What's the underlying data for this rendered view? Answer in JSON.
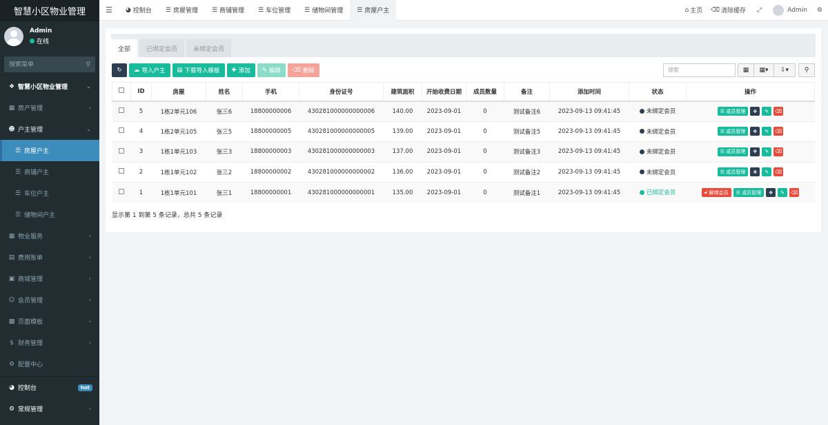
{
  "brand": "智慧小区物业管理",
  "user": {
    "name": "Admin",
    "status": "在线"
  },
  "sidebar": {
    "search_placeholder": "搜索菜单",
    "items": [
      {
        "label": "智慧小区物业管理",
        "icon": "cubes-icon"
      },
      {
        "label": "房产管理",
        "icon": "building-icon"
      },
      {
        "label": "户主管理",
        "icon": "user-icon"
      },
      {
        "label": "房屋户主",
        "icon": "list-icon"
      },
      {
        "label": "商铺户主",
        "icon": "list-icon"
      },
      {
        "label": "车位户主",
        "icon": "list-icon"
      },
      {
        "label": "储物间户主",
        "icon": "list-icon"
      },
      {
        "label": "物业服务",
        "icon": "table-icon"
      },
      {
        "label": "费用账单",
        "icon": "file-icon"
      },
      {
        "label": "商城管理",
        "icon": "store-icon"
      },
      {
        "label": "会员管理",
        "icon": "user-circle-icon"
      },
      {
        "label": "页面模板",
        "icon": "window-icon"
      },
      {
        "label": "财务管理",
        "icon": "dollar-icon"
      },
      {
        "label": "配置中心",
        "icon": "gear-icon"
      },
      {
        "label": "控制台",
        "icon": "dashboard-icon",
        "badge": "hot"
      },
      {
        "label": "常规管理",
        "icon": "cogs-icon"
      }
    ]
  },
  "topbar": {
    "tabs": [
      {
        "label": "控制台",
        "icon": "dashboard-icon"
      },
      {
        "label": "房屋管理",
        "icon": "list-icon"
      },
      {
        "label": "商铺管理",
        "icon": "list-icon"
      },
      {
        "label": "车位管理",
        "icon": "list-icon"
      },
      {
        "label": "储物间管理",
        "icon": "list-icon"
      },
      {
        "label": "房屋户主",
        "icon": "list-icon"
      }
    ],
    "home": "主页",
    "clear_cache": "清除缓存",
    "user": "Admin"
  },
  "panel": {
    "tabs": [
      "全部",
      "已绑定会员",
      "未绑定会员"
    ],
    "buttons": {
      "import": "导入户主",
      "download": "下载导入模板",
      "add": "添加",
      "edit": "编辑",
      "delete": "删除"
    },
    "search_placeholder": "搜索",
    "columns": [
      "ID",
      "房屋",
      "姓名",
      "手机",
      "身份证号",
      "建筑面积",
      "开始收费日期",
      "成员数量",
      "备注",
      "添加时间",
      "状态",
      "操作"
    ],
    "rows": [
      {
        "id": "5",
        "house": "1栋2单元106",
        "name": "张三6",
        "phone": "18800000006",
        "idcard": "430281000000000006",
        "area": "140.00",
        "start": "2023-09-01",
        "members": "0",
        "remark": "测试备注6",
        "added": "2023-09-13 09:41:45",
        "status": "未绑定会员",
        "bound": false
      },
      {
        "id": "4",
        "house": "1栋2单元105",
        "name": "张三5",
        "phone": "18800000005",
        "idcard": "430281000000000005",
        "area": "139.00",
        "start": "2023-09-01",
        "members": "0",
        "remark": "测试备注5",
        "added": "2023-09-13 09:41:45",
        "status": "未绑定会员",
        "bound": false
      },
      {
        "id": "3",
        "house": "1栋1单元103",
        "name": "张三3",
        "phone": "18800000003",
        "idcard": "430281000000000003",
        "area": "137.00",
        "start": "2023-09-01",
        "members": "0",
        "remark": "测试备注3",
        "added": "2023-09-13 09:41:45",
        "status": "未绑定会员",
        "bound": false
      },
      {
        "id": "2",
        "house": "1栋1单元102",
        "name": "张三2",
        "phone": "18800000002",
        "idcard": "430281000000000002",
        "area": "136.00",
        "start": "2023-09-01",
        "members": "0",
        "remark": "测试备注2",
        "added": "2023-09-13 09:41:45",
        "status": "未绑定会员",
        "bound": false
      },
      {
        "id": "1",
        "house": "1栋1单元101",
        "name": "张三1",
        "phone": "18800000001",
        "idcard": "430281000000000001",
        "area": "135.00",
        "start": "2023-09-01",
        "members": "0",
        "remark": "测试备注1",
        "added": "2023-09-13 09:41:45",
        "status": "已绑定会员",
        "bound": true
      }
    ],
    "op_member": "成员管理",
    "op_unbind": "解绑会员",
    "summary": "显示第 1 到第 5 条记录，总共 5 条记录"
  }
}
